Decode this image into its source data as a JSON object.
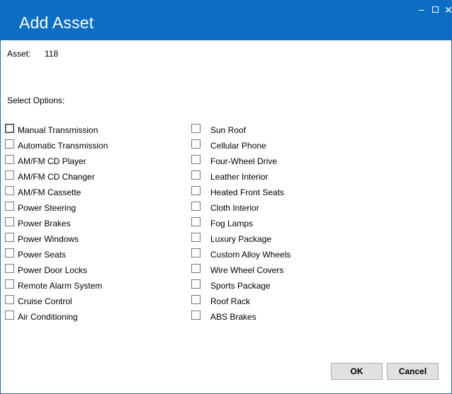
{
  "window": {
    "title": "Add Asset"
  },
  "asset": {
    "label": "Asset:",
    "value": "118"
  },
  "options_label": "Select Options:",
  "options_left": [
    "Manual Transmission",
    "Automatic Transmission",
    "AM/FM CD Player",
    "AM/FM CD Changer",
    "AM/FM Cassette",
    "Power Steering",
    "Power Brakes",
    "Power Windows",
    "Power Seats",
    "Power Door Locks",
    "Remote Alarm System",
    "Cruise Control",
    "Air Conditioning"
  ],
  "options_right": [
    "Sun Roof",
    "Cellular Phone",
    "Four-Wheel Drive",
    "Leather Interior",
    "Heated Front Seats",
    "Cloth Interior",
    "Fog Lamps",
    "Luxury Package",
    "Custom Alloy Wheels",
    "Wire Wheel Covers",
    "Sports Package",
    "Roof Rack",
    "ABS Brakes"
  ],
  "buttons": {
    "ok": "OK",
    "cancel": "Cancel"
  },
  "icons": {
    "minimize": "minimize-icon",
    "maximize": "maximize-icon",
    "close": "close-icon"
  },
  "colors": {
    "titlebar": "#0b6dc3"
  }
}
